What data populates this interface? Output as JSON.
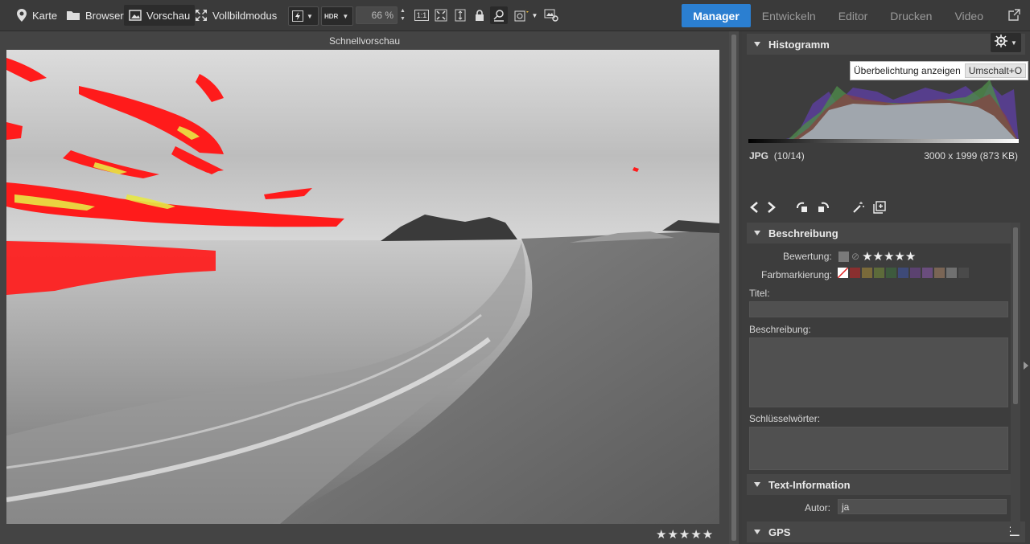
{
  "toolbar": {
    "map_label": "Karte",
    "browser_label": "Browser",
    "preview_label": "Vorschau",
    "fullscreen_label": "Vollbildmodus",
    "hdr_label": "HDR",
    "zoom_value": "66 %",
    "one_to_one_label": "1:1"
  },
  "modules": {
    "tabs": [
      {
        "label": "Manager",
        "active": true
      },
      {
        "label": "Entwickeln",
        "active": false
      },
      {
        "label": "Editor",
        "active": false
      },
      {
        "label": "Drucken",
        "active": false
      },
      {
        "label": "Video",
        "active": false
      }
    ]
  },
  "preview": {
    "title": "Schnellvorschau",
    "rating_stars": "★★★★★"
  },
  "histogram": {
    "header": "Histogramm",
    "tooltip_text": "Überbelichtung anzeigen",
    "tooltip_shortcut": "Umschalt+O",
    "file_type": "JPG",
    "file_index": "(10/14)",
    "file_dims": "3000 x 1999 (873 KB)"
  },
  "description": {
    "header": "Beschreibung",
    "rating_label": "Bewertung:",
    "rating_stars": "★★★★★",
    "color_label": "Farbmarkierung:",
    "title_label": "Titel:",
    "title_value": "",
    "desc_label": "Beschreibung:",
    "desc_value": "",
    "keywords_label": "Schlüsselwörter:",
    "keywords_value": "",
    "colors": [
      "#8a2f2f",
      "#7a6a3a",
      "#5d6b3a",
      "#3d5a3d",
      "#3e4a78",
      "#5b4270",
      "#6a4d7d",
      "#7a6555",
      "#707070",
      "#4a4a4a"
    ]
  },
  "text_info": {
    "header": "Text-Information",
    "author_label": "Autor:",
    "author_value": "ja"
  },
  "gps": {
    "header": "GPS"
  },
  "colors": {
    "accent": "#2b7fd1",
    "overexposure": "#ff0000"
  }
}
